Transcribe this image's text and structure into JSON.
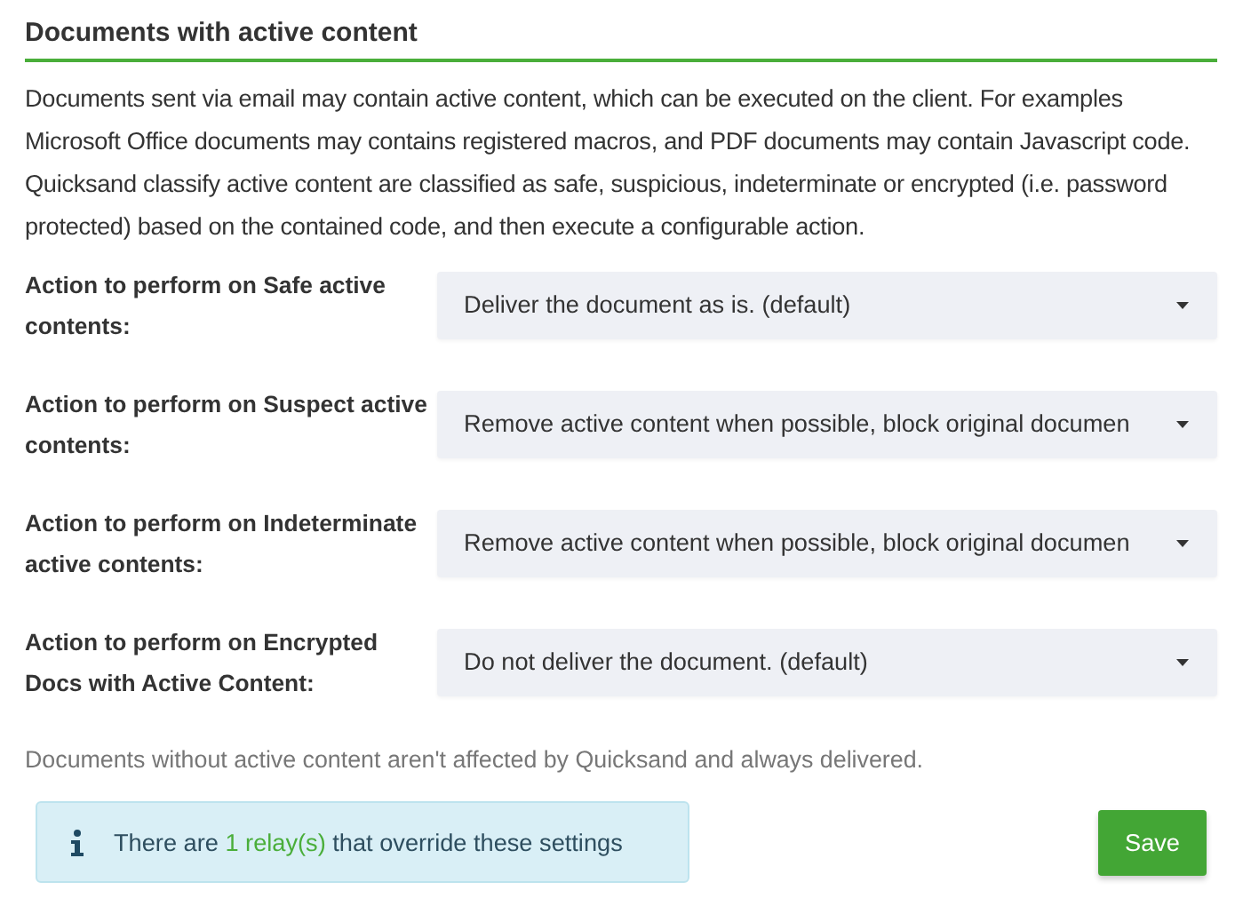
{
  "section": {
    "title": "Documents with active content",
    "description": "Documents sent via email may contain active content, which can be executed on the client. For examples Microsoft Office documents may contains registered macros, and PDF documents may contain Javascript code. Quicksand classify active content are classified as safe, suspicious, indeterminate or encrypted (i.e. password protected) based on the contained code, and then execute a configurable action."
  },
  "actions": [
    {
      "label": "Action to perform on Safe active contents:",
      "value": "Deliver the document as is. (default)"
    },
    {
      "label": "Action to perform on Suspect active contents:",
      "value": "Remove active content when possible, block original documen"
    },
    {
      "label": "Action to perform on Indeterminate active contents:",
      "value": "Remove active content when possible, block original documen"
    },
    {
      "label": "Action to perform on Encrypted Docs with Active Content:",
      "value": "Do not deliver the document. (default)"
    }
  ],
  "note": "Documents without active content aren't affected by Quicksand and always delivered.",
  "info": {
    "prefix": "There are ",
    "link": "1 relay(s)",
    "suffix": " that override these settings"
  },
  "buttons": [
    "Save"
  ]
}
